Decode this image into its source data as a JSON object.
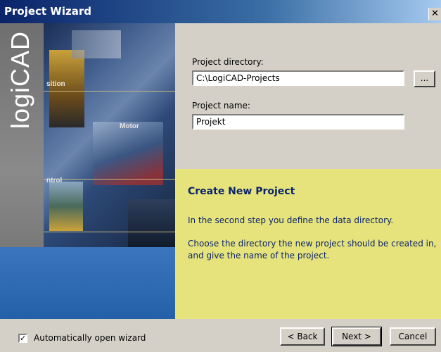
{
  "window": {
    "title": "Project Wizard",
    "close_glyph": "✕"
  },
  "branding": {
    "logo_text": "logiCAD",
    "image_labels": [
      "sition",
      "Motor",
      "ntrol"
    ]
  },
  "form": {
    "directory_label": "Project directory:",
    "directory_value": "C:\\LogiCAD-Projects",
    "browse_label": "...",
    "name_label": "Project name:",
    "name_value": "Projekt"
  },
  "info": {
    "heading": "Create New Project",
    "line1": "In the second step you define the data directory.",
    "line2": "Choose the directory the new project should be created in, and give the name of the project."
  },
  "footer": {
    "auto_open_label": "Automatically open wizard",
    "auto_open_checked": true,
    "back_label": "< Back",
    "next_label": "Next >",
    "cancel_label": "Cancel"
  },
  "colors": {
    "title_start": "#0a246a",
    "title_end": "#a6caf0",
    "info_bg": "#e6e37d",
    "info_text": "#0a246a",
    "window_bg": "#d4d0c8"
  },
  "icons": [
    "close-icon",
    "checkmark-icon"
  ]
}
